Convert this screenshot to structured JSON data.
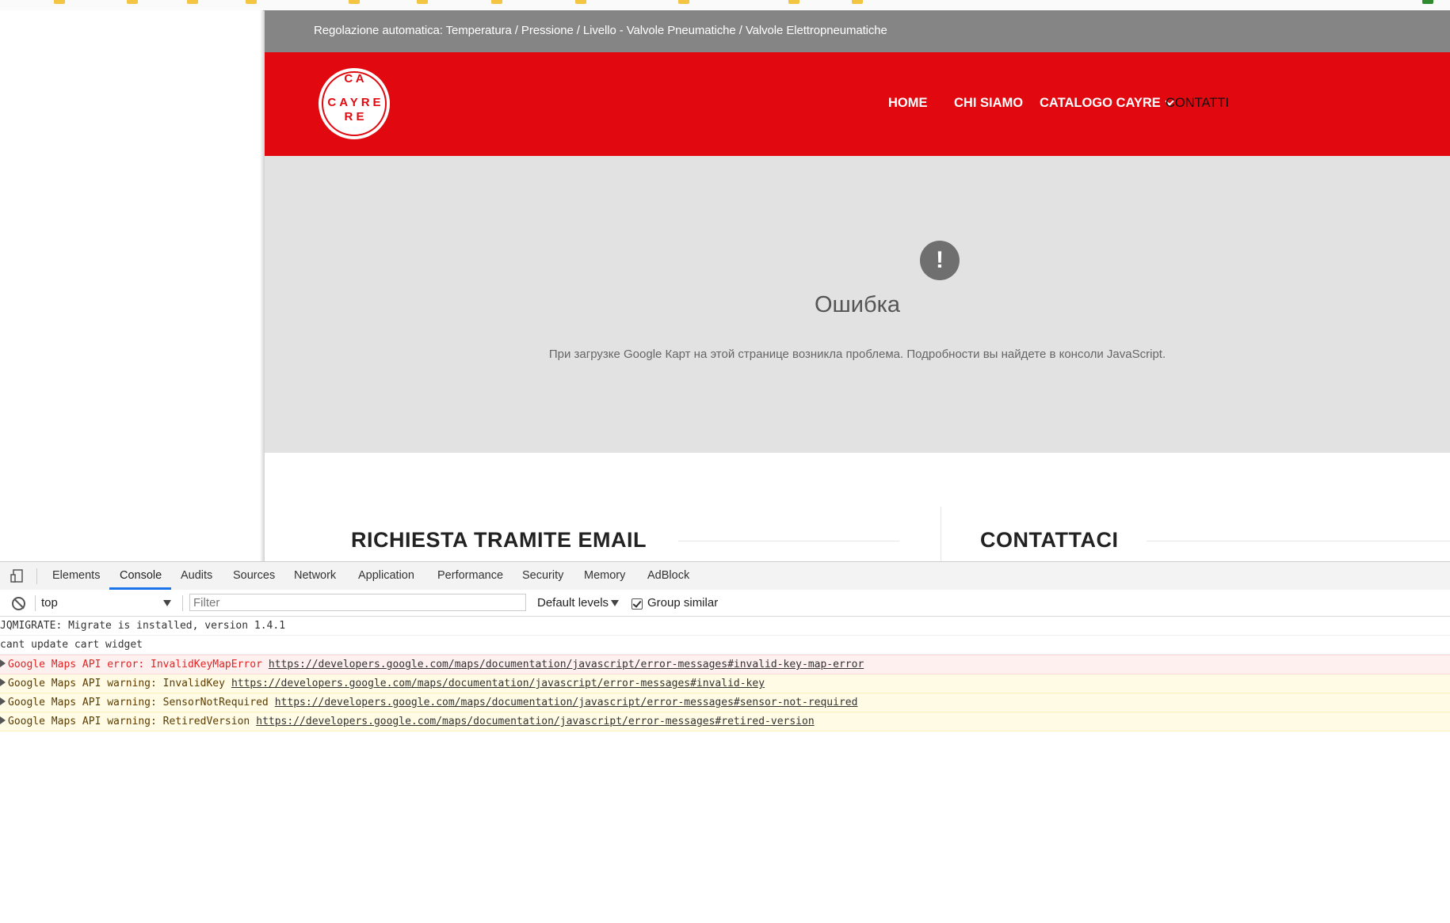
{
  "site": {
    "topbar_text": "Regolazione automatica: Temperatura / Pressione / Livello - Valvole Pneumatiche / Valvole Elettropneumatiche",
    "logo": {
      "horizontal": "CAYRE",
      "vertical_top": "C A",
      "vertical_bottom": "R E"
    },
    "nav": {
      "home": "HOME",
      "about": "CHI SIAMO",
      "catalog": "CATALOGO CAYRE",
      "contacts": "CONTATTI"
    },
    "map_error": {
      "icon": "!",
      "title": "Ошибка",
      "message": "При загрузке Google Карт на этой странице возникла проблема. Подробности вы найдете в консоли JavaScript."
    },
    "sections": {
      "email_heading": "RICHIESTA TRAMITE EMAIL",
      "contact_heading": "CONTATTACI"
    },
    "colors": {
      "brand_red": "#e1090f",
      "topbar_gray": "#858585"
    }
  },
  "devtools": {
    "tabs": [
      "Elements",
      "Console",
      "Audits",
      "Sources",
      "Network",
      "Application",
      "Performance",
      "Security",
      "Memory",
      "AdBlock"
    ],
    "active_tab": "Console",
    "toolbar": {
      "context": "top",
      "filter_placeholder": "Filter",
      "levels": "Default levels",
      "group_similar": "Group similar",
      "group_similar_checked": true
    },
    "console": {
      "line1": "JQMIGRATE: Migrate is installed, version 1.4.1",
      "line2": "cant update cart widget",
      "error1": {
        "text": "Google Maps API error: InvalidKeyMapError",
        "link": "https://developers.google.com/maps/documentation/javascript/error-messages#invalid-key-map-error"
      },
      "warn1": {
        "text": "Google Maps API warning: InvalidKey",
        "link": "https://developers.google.com/maps/documentation/javascript/error-messages#invalid-key"
      },
      "warn2": {
        "text": "Google Maps API warning: SensorNotRequired",
        "link": "https://developers.google.com/maps/documentation/javascript/error-messages#sensor-not-required"
      },
      "warn3": {
        "text": "Google Maps API warning: RetiredVersion",
        "link": "https://developers.google.com/maps/documentation/javascript/error-messages#retired-version"
      }
    }
  }
}
